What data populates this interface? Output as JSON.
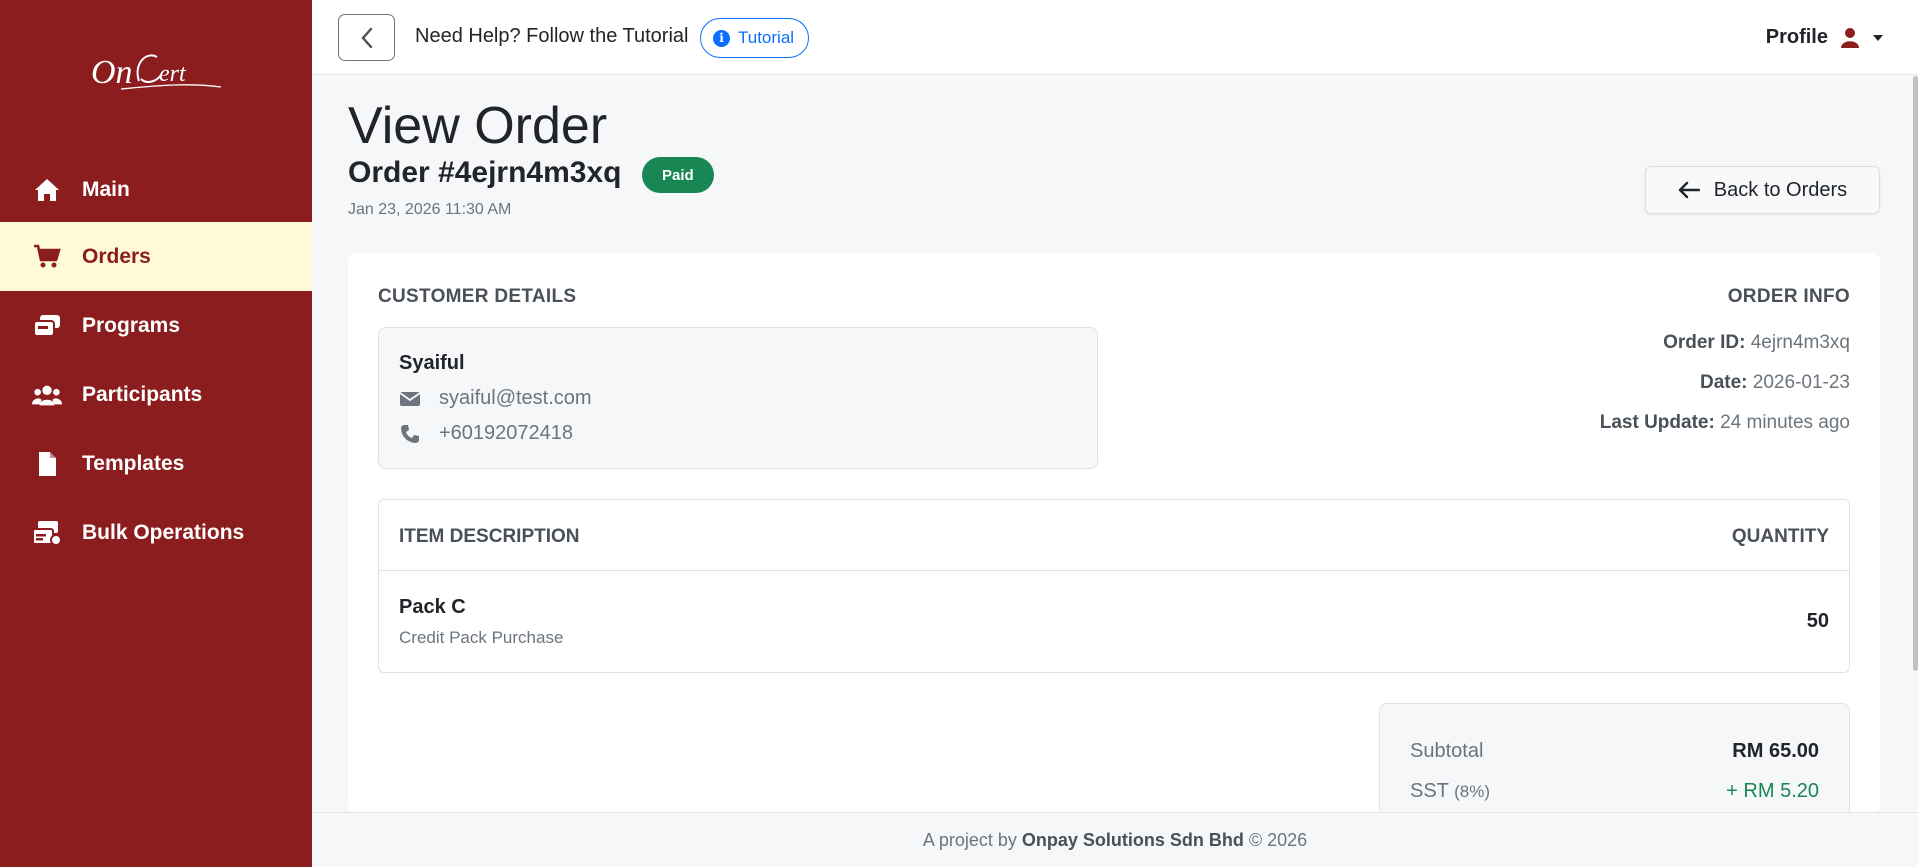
{
  "app": {
    "logo_text": "OnCert"
  },
  "sidebar": {
    "items": [
      {
        "label": "Main",
        "icon": "home-icon"
      },
      {
        "label": "Orders",
        "icon": "cart-icon",
        "active": true
      },
      {
        "label": "Programs",
        "icon": "cards-icon"
      },
      {
        "label": "Participants",
        "icon": "users-icon"
      },
      {
        "label": "Templates",
        "icon": "file-icon"
      },
      {
        "label": "Bulk Operations",
        "icon": "bulk-icon"
      }
    ]
  },
  "topbar": {
    "help_text": "Need Help? Follow the Tutorial",
    "tutorial_label": "Tutorial",
    "profile_label": "Profile"
  },
  "header": {
    "title": "View Order",
    "order_number": "Order #4ejrn4m3xq",
    "status": "Paid",
    "datetime": "Jan 23, 2026 11:30 AM",
    "back_label": "Back to Orders"
  },
  "customer": {
    "heading": "CUSTOMER DETAILS",
    "name": "Syaiful",
    "email": "syaiful@test.com",
    "phone": "+60192072418"
  },
  "order_info": {
    "heading": "ORDER INFO",
    "id_label": "Order ID:",
    "id_value": "4ejrn4m3xq",
    "date_label": "Date:",
    "date_value": "2026-01-23",
    "update_label": "Last Update:",
    "update_value": "24 minutes ago"
  },
  "items": {
    "col_description": "ITEM DESCRIPTION",
    "col_quantity": "QUANTITY",
    "rows": [
      {
        "name": "Pack C",
        "description": "Credit Pack Purchase",
        "quantity": "50"
      }
    ]
  },
  "summary": {
    "subtotal_label": "Subtotal",
    "subtotal_value": "RM 65.00",
    "sst_label": "SST",
    "sst_rate": "(8%)",
    "sst_value": "+ RM 5.20"
  },
  "footer": {
    "prefix": "A project by",
    "company": "Onpay Solutions Sdn Bhd",
    "suffix": "© 2026"
  },
  "colors": {
    "sidebar_bg": "#8b1d1f",
    "active_bg": "#fef9d6",
    "paid_badge": "#198754",
    "accent_blue": "#0d6efd"
  }
}
